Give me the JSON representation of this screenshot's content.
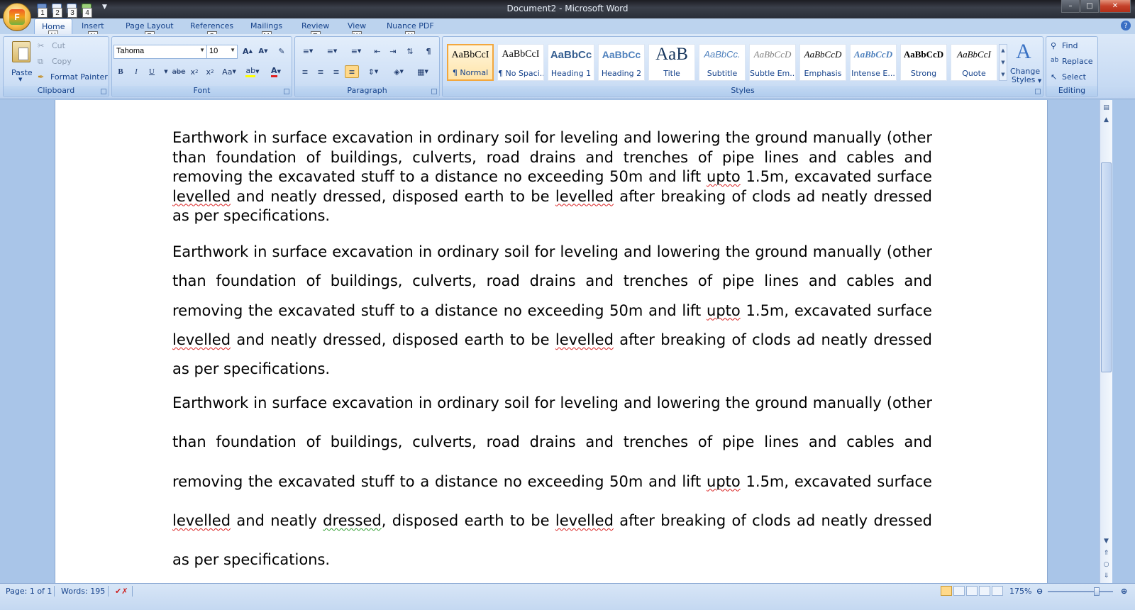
{
  "window": {
    "title": "Document2 - Microsoft Word"
  },
  "office_button": {
    "logo": "F"
  },
  "qat": {
    "items": [
      {
        "icon": "save-icon",
        "keytip": "1"
      },
      {
        "icon": "undo-icon",
        "keytip": "2"
      },
      {
        "icon": "redo-icon",
        "keytip": "3"
      },
      {
        "icon": "print-icon",
        "keytip": "4"
      }
    ]
  },
  "tabs": [
    {
      "label": "Home",
      "keytip": "H"
    },
    {
      "label": "Insert",
      "keytip": "N"
    },
    {
      "label": "Page Layout",
      "keytip": "P"
    },
    {
      "label": "References",
      "keytip": "S"
    },
    {
      "label": "Mailings",
      "keytip": "M"
    },
    {
      "label": "Review",
      "keytip": "R"
    },
    {
      "label": "View",
      "keytip": "W"
    },
    {
      "label": "Nuance PDF",
      "keytip": "Y"
    }
  ],
  "clipboard": {
    "group": "Clipboard",
    "paste": "Paste",
    "cut": "Cut",
    "copy": "Copy",
    "format_painter": "Format Painter"
  },
  "font": {
    "group": "Font",
    "name": "Tahoma",
    "size": "10"
  },
  "paragraph": {
    "group": "Paragraph"
  },
  "styles": {
    "group": "Styles",
    "items": [
      {
        "sample": "AaBbCcI",
        "name": "¶ Normal"
      },
      {
        "sample": "AaBbCcI",
        "name": "¶ No Spaci..."
      },
      {
        "sample": "AaBbCc",
        "name": "Heading 1"
      },
      {
        "sample": "AaBbCc",
        "name": "Heading 2"
      },
      {
        "sample": "AaB",
        "name": "Title"
      },
      {
        "sample": "AaBbCc.",
        "name": "Subtitle"
      },
      {
        "sample": "AaBbCcD",
        "name": "Subtle Em..."
      },
      {
        "sample": "AaBbCcD",
        "name": "Emphasis"
      },
      {
        "sample": "AaBbCcD",
        "name": "Intense E..."
      },
      {
        "sample": "AaBbCcD",
        "name": "Strong"
      },
      {
        "sample": "AaBbCcI",
        "name": "Quote"
      }
    ],
    "change_styles_1": "Change",
    "change_styles_2": "Styles"
  },
  "editing": {
    "group": "Editing",
    "find": "Find",
    "replace": "Replace",
    "select": "Select"
  },
  "document": {
    "p_a": "Earthwork in surface excavation in ordinary soil for leveling and lowering the ground manually (other than foundation of buildings, culverts, road drains and trenches of pipe lines and cables and removing the excavated stuff to a distance no exceeding 50m and lift ",
    "w_upto": "upto",
    "p_b": " 1.5m, excavated surface ",
    "w_levelled": "levelled",
    "p_c": " and neatly ",
    "w_dressed": "dressed",
    "p_d": ", disposed earth to be ",
    "p_e": " after breaking of clods ad neatly dressed as per specifications."
  },
  "status": {
    "page": "Page: 1 of 1",
    "words": "Words: 195",
    "zoom": "175%",
    "zoom_fraction": 0.75
  }
}
